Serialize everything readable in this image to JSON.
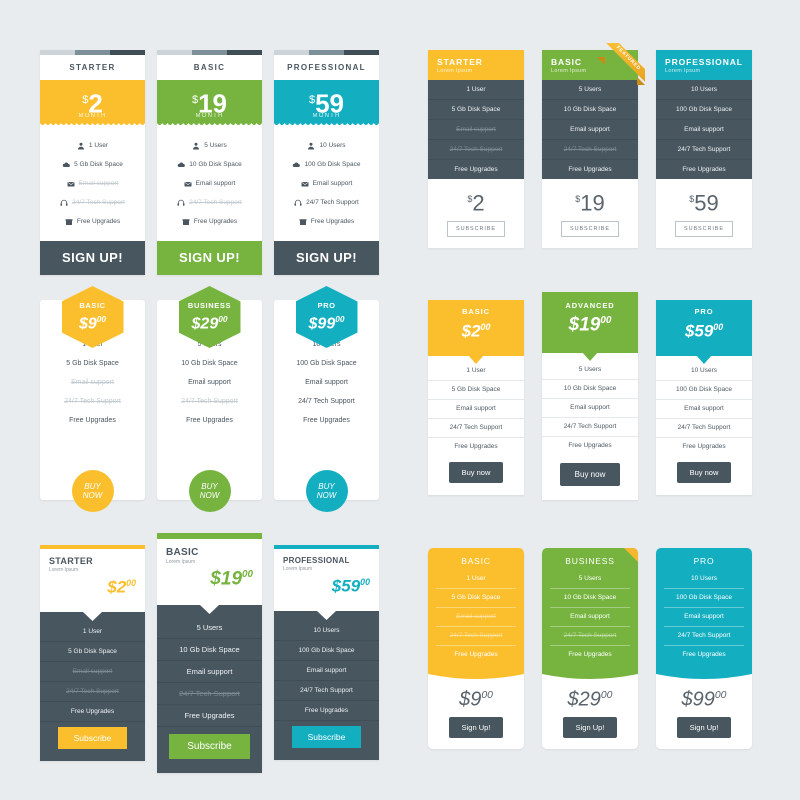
{
  "colors": {
    "page_bg": "#e9ecef",
    "yellow": "#fbbf2d",
    "green": "#76b43f",
    "teal": "#13afc0",
    "dark": "#48565f"
  },
  "features": {
    "users_1": "1 User",
    "users_5": "5 Users",
    "users_10": "10 Users",
    "disk_5": "5 Gb Disk Space",
    "disk_10": "10 Gb Disk Space",
    "disk_100": "100 Gb Disk Space",
    "email": "Email support",
    "tech": "24/7 Tech Support",
    "upgrades": "Free Upgrades"
  },
  "block1": {
    "cards": [
      {
        "title": "STARTER",
        "currency": "$",
        "amount": "2",
        "period": "MONTH",
        "button": "SIGN UP!"
      },
      {
        "title": "BASIC",
        "currency": "$",
        "amount": "19",
        "period": "MONTH",
        "button": "SIGN UP!"
      },
      {
        "title": "PROFESSIONAL",
        "currency": "$",
        "amount": "59",
        "period": "MONTH",
        "button": "SIGN UP!"
      }
    ]
  },
  "block2": {
    "ribbon_label": "FEATURED",
    "cards": [
      {
        "title": "STARTER",
        "subtitle": "Lorem Ipsum",
        "currency": "$",
        "amount": "2",
        "button": "SUBSCRIBE"
      },
      {
        "title": "BASIC",
        "subtitle": "Lorem Ipsum",
        "currency": "$",
        "amount": "19",
        "button": "SUBSCRIBE"
      },
      {
        "title": "PROFESSIONAL",
        "subtitle": "Lorem Ipsum",
        "currency": "$",
        "amount": "59",
        "button": "SUBSCRIBE"
      }
    ]
  },
  "block3": {
    "cards": [
      {
        "title": "BASIC",
        "currency": "$",
        "amount": "9",
        "cents": "00",
        "button_line1": "BUY",
        "button_line2": "NOW"
      },
      {
        "title": "BUSINESS",
        "currency": "$",
        "amount": "29",
        "cents": "00",
        "button_line1": "BUY",
        "button_line2": "NOW"
      },
      {
        "title": "PRO",
        "currency": "$",
        "amount": "99",
        "cents": "00",
        "button_line1": "BUY",
        "button_line2": "NOW"
      }
    ]
  },
  "block4": {
    "cards": [
      {
        "title": "BASIC",
        "currency": "$",
        "amount": "2",
        "cents": "00",
        "button": "Buy now"
      },
      {
        "title": "ADVANCED",
        "currency": "$",
        "amount": "19",
        "cents": "00",
        "button": "Buy now"
      },
      {
        "title": "PRO",
        "currency": "$",
        "amount": "59",
        "cents": "00",
        "button": "Buy now"
      }
    ]
  },
  "block5": {
    "cards": [
      {
        "title": "STARTER",
        "subtitle": "Lorem Ipsum",
        "currency": "$",
        "amount": "2",
        "cents": "00",
        "button": "Subscribe"
      },
      {
        "title": "BASIC",
        "subtitle": "Lorem Ipsum",
        "currency": "$",
        "amount": "19",
        "cents": "00",
        "button": "Subscribe"
      },
      {
        "title": "PROFESSIONAL",
        "subtitle": "Lorem Ipsum",
        "currency": "$",
        "amount": "59",
        "cents": "00",
        "button": "Subscribe"
      }
    ]
  },
  "block6": {
    "cards": [
      {
        "title": "BASIC",
        "currency": "$",
        "amount": "9",
        "cents": "00",
        "button": "Sign Up!"
      },
      {
        "title": "BUSINESS",
        "currency": "$",
        "amount": "29",
        "cents": "00",
        "button": "Sign Up!"
      },
      {
        "title": "PRO",
        "currency": "$",
        "amount": "99",
        "cents": "00",
        "button": "Sign Up!"
      }
    ]
  }
}
